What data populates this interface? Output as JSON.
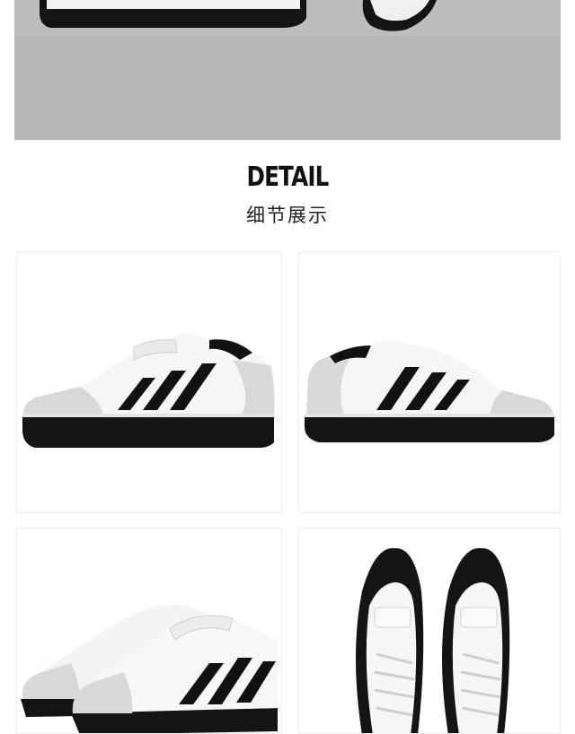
{
  "detail": {
    "title": "DETAIL",
    "subtitle": "细节展示"
  },
  "images": {
    "hero": "shoes-on-grey-floor-photo",
    "tile_1": "sneaker-side-view-left",
    "tile_2": "sneaker-side-view-right",
    "tile_3": "sneaker-pair-angled",
    "tile_4": "sneaker-pair-top-view"
  },
  "colors": {
    "upper": "#f6f6f4",
    "suede": "#dcdcda",
    "stripes": "#111111",
    "sole": "#151515"
  }
}
